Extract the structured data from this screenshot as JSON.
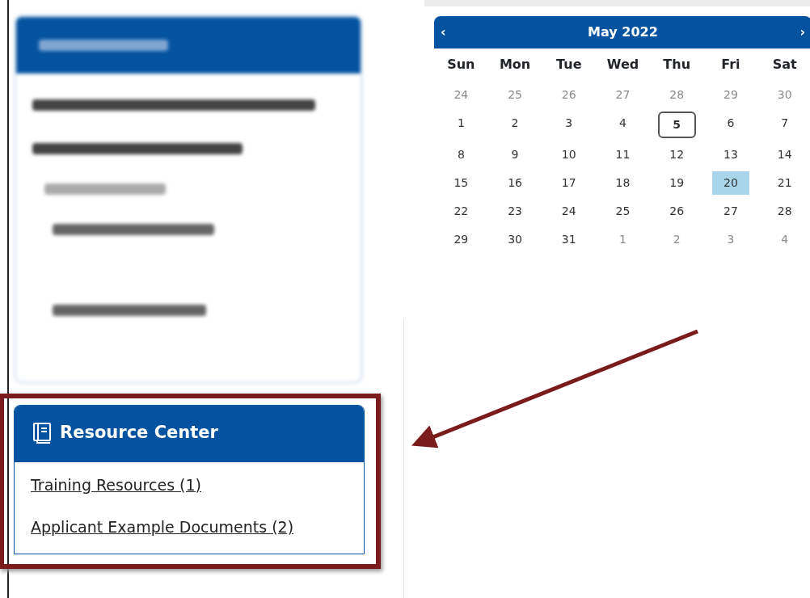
{
  "apply_panel": {
    "kind": "blurred"
  },
  "calendar": {
    "title": "May 2022",
    "prev": "‹",
    "next": "›",
    "weekdays": [
      "Sun",
      "Mon",
      "Tue",
      "Wed",
      "Thu",
      "Fri",
      "Sat"
    ],
    "weeks": [
      [
        {
          "d": "24",
          "outside": true,
          "today": false,
          "selected": false
        },
        {
          "d": "25",
          "outside": true,
          "today": false,
          "selected": false
        },
        {
          "d": "26",
          "outside": true,
          "today": false,
          "selected": false
        },
        {
          "d": "27",
          "outside": true,
          "today": false,
          "selected": false
        },
        {
          "d": "28",
          "outside": true,
          "today": false,
          "selected": false
        },
        {
          "d": "29",
          "outside": true,
          "today": false,
          "selected": false
        },
        {
          "d": "30",
          "outside": true,
          "today": false,
          "selected": false
        }
      ],
      [
        {
          "d": "1",
          "outside": false,
          "today": false,
          "selected": false
        },
        {
          "d": "2",
          "outside": false,
          "today": false,
          "selected": false
        },
        {
          "d": "3",
          "outside": false,
          "today": false,
          "selected": false
        },
        {
          "d": "4",
          "outside": false,
          "today": false,
          "selected": false
        },
        {
          "d": "5",
          "outside": false,
          "today": true,
          "selected": false
        },
        {
          "d": "6",
          "outside": false,
          "today": false,
          "selected": false
        },
        {
          "d": "7",
          "outside": false,
          "today": false,
          "selected": false
        }
      ],
      [
        {
          "d": "8",
          "outside": false,
          "today": false,
          "selected": false
        },
        {
          "d": "9",
          "outside": false,
          "today": false,
          "selected": false
        },
        {
          "d": "10",
          "outside": false,
          "today": false,
          "selected": false
        },
        {
          "d": "11",
          "outside": false,
          "today": false,
          "selected": false
        },
        {
          "d": "12",
          "outside": false,
          "today": false,
          "selected": false
        },
        {
          "d": "13",
          "outside": false,
          "today": false,
          "selected": false
        },
        {
          "d": "14",
          "outside": false,
          "today": false,
          "selected": false
        }
      ],
      [
        {
          "d": "15",
          "outside": false,
          "today": false,
          "selected": false
        },
        {
          "d": "16",
          "outside": false,
          "today": false,
          "selected": false
        },
        {
          "d": "17",
          "outside": false,
          "today": false,
          "selected": false
        },
        {
          "d": "18",
          "outside": false,
          "today": false,
          "selected": false
        },
        {
          "d": "19",
          "outside": false,
          "today": false,
          "selected": false
        },
        {
          "d": "20",
          "outside": false,
          "today": false,
          "selected": true
        },
        {
          "d": "21",
          "outside": false,
          "today": false,
          "selected": false
        }
      ],
      [
        {
          "d": "22",
          "outside": false,
          "today": false,
          "selected": false
        },
        {
          "d": "23",
          "outside": false,
          "today": false,
          "selected": false
        },
        {
          "d": "24",
          "outside": false,
          "today": false,
          "selected": false
        },
        {
          "d": "25",
          "outside": false,
          "today": false,
          "selected": false
        },
        {
          "d": "26",
          "outside": false,
          "today": false,
          "selected": false
        },
        {
          "d": "27",
          "outside": false,
          "today": false,
          "selected": false
        },
        {
          "d": "28",
          "outside": false,
          "today": false,
          "selected": false
        }
      ],
      [
        {
          "d": "29",
          "outside": false,
          "today": false,
          "selected": false
        },
        {
          "d": "30",
          "outside": false,
          "today": false,
          "selected": false
        },
        {
          "d": "31",
          "outside": false,
          "today": false,
          "selected": false
        },
        {
          "d": "1",
          "outside": true,
          "today": false,
          "selected": false
        },
        {
          "d": "2",
          "outside": true,
          "today": false,
          "selected": false
        },
        {
          "d": "3",
          "outside": true,
          "today": false,
          "selected": false
        },
        {
          "d": "4",
          "outside": true,
          "today": false,
          "selected": false
        }
      ]
    ]
  },
  "resource_center": {
    "title": "Resource Center",
    "highlighted": true,
    "links": [
      {
        "label": "Training Resources (1)"
      },
      {
        "label": "Applicant Example Documents (2)"
      }
    ]
  }
}
